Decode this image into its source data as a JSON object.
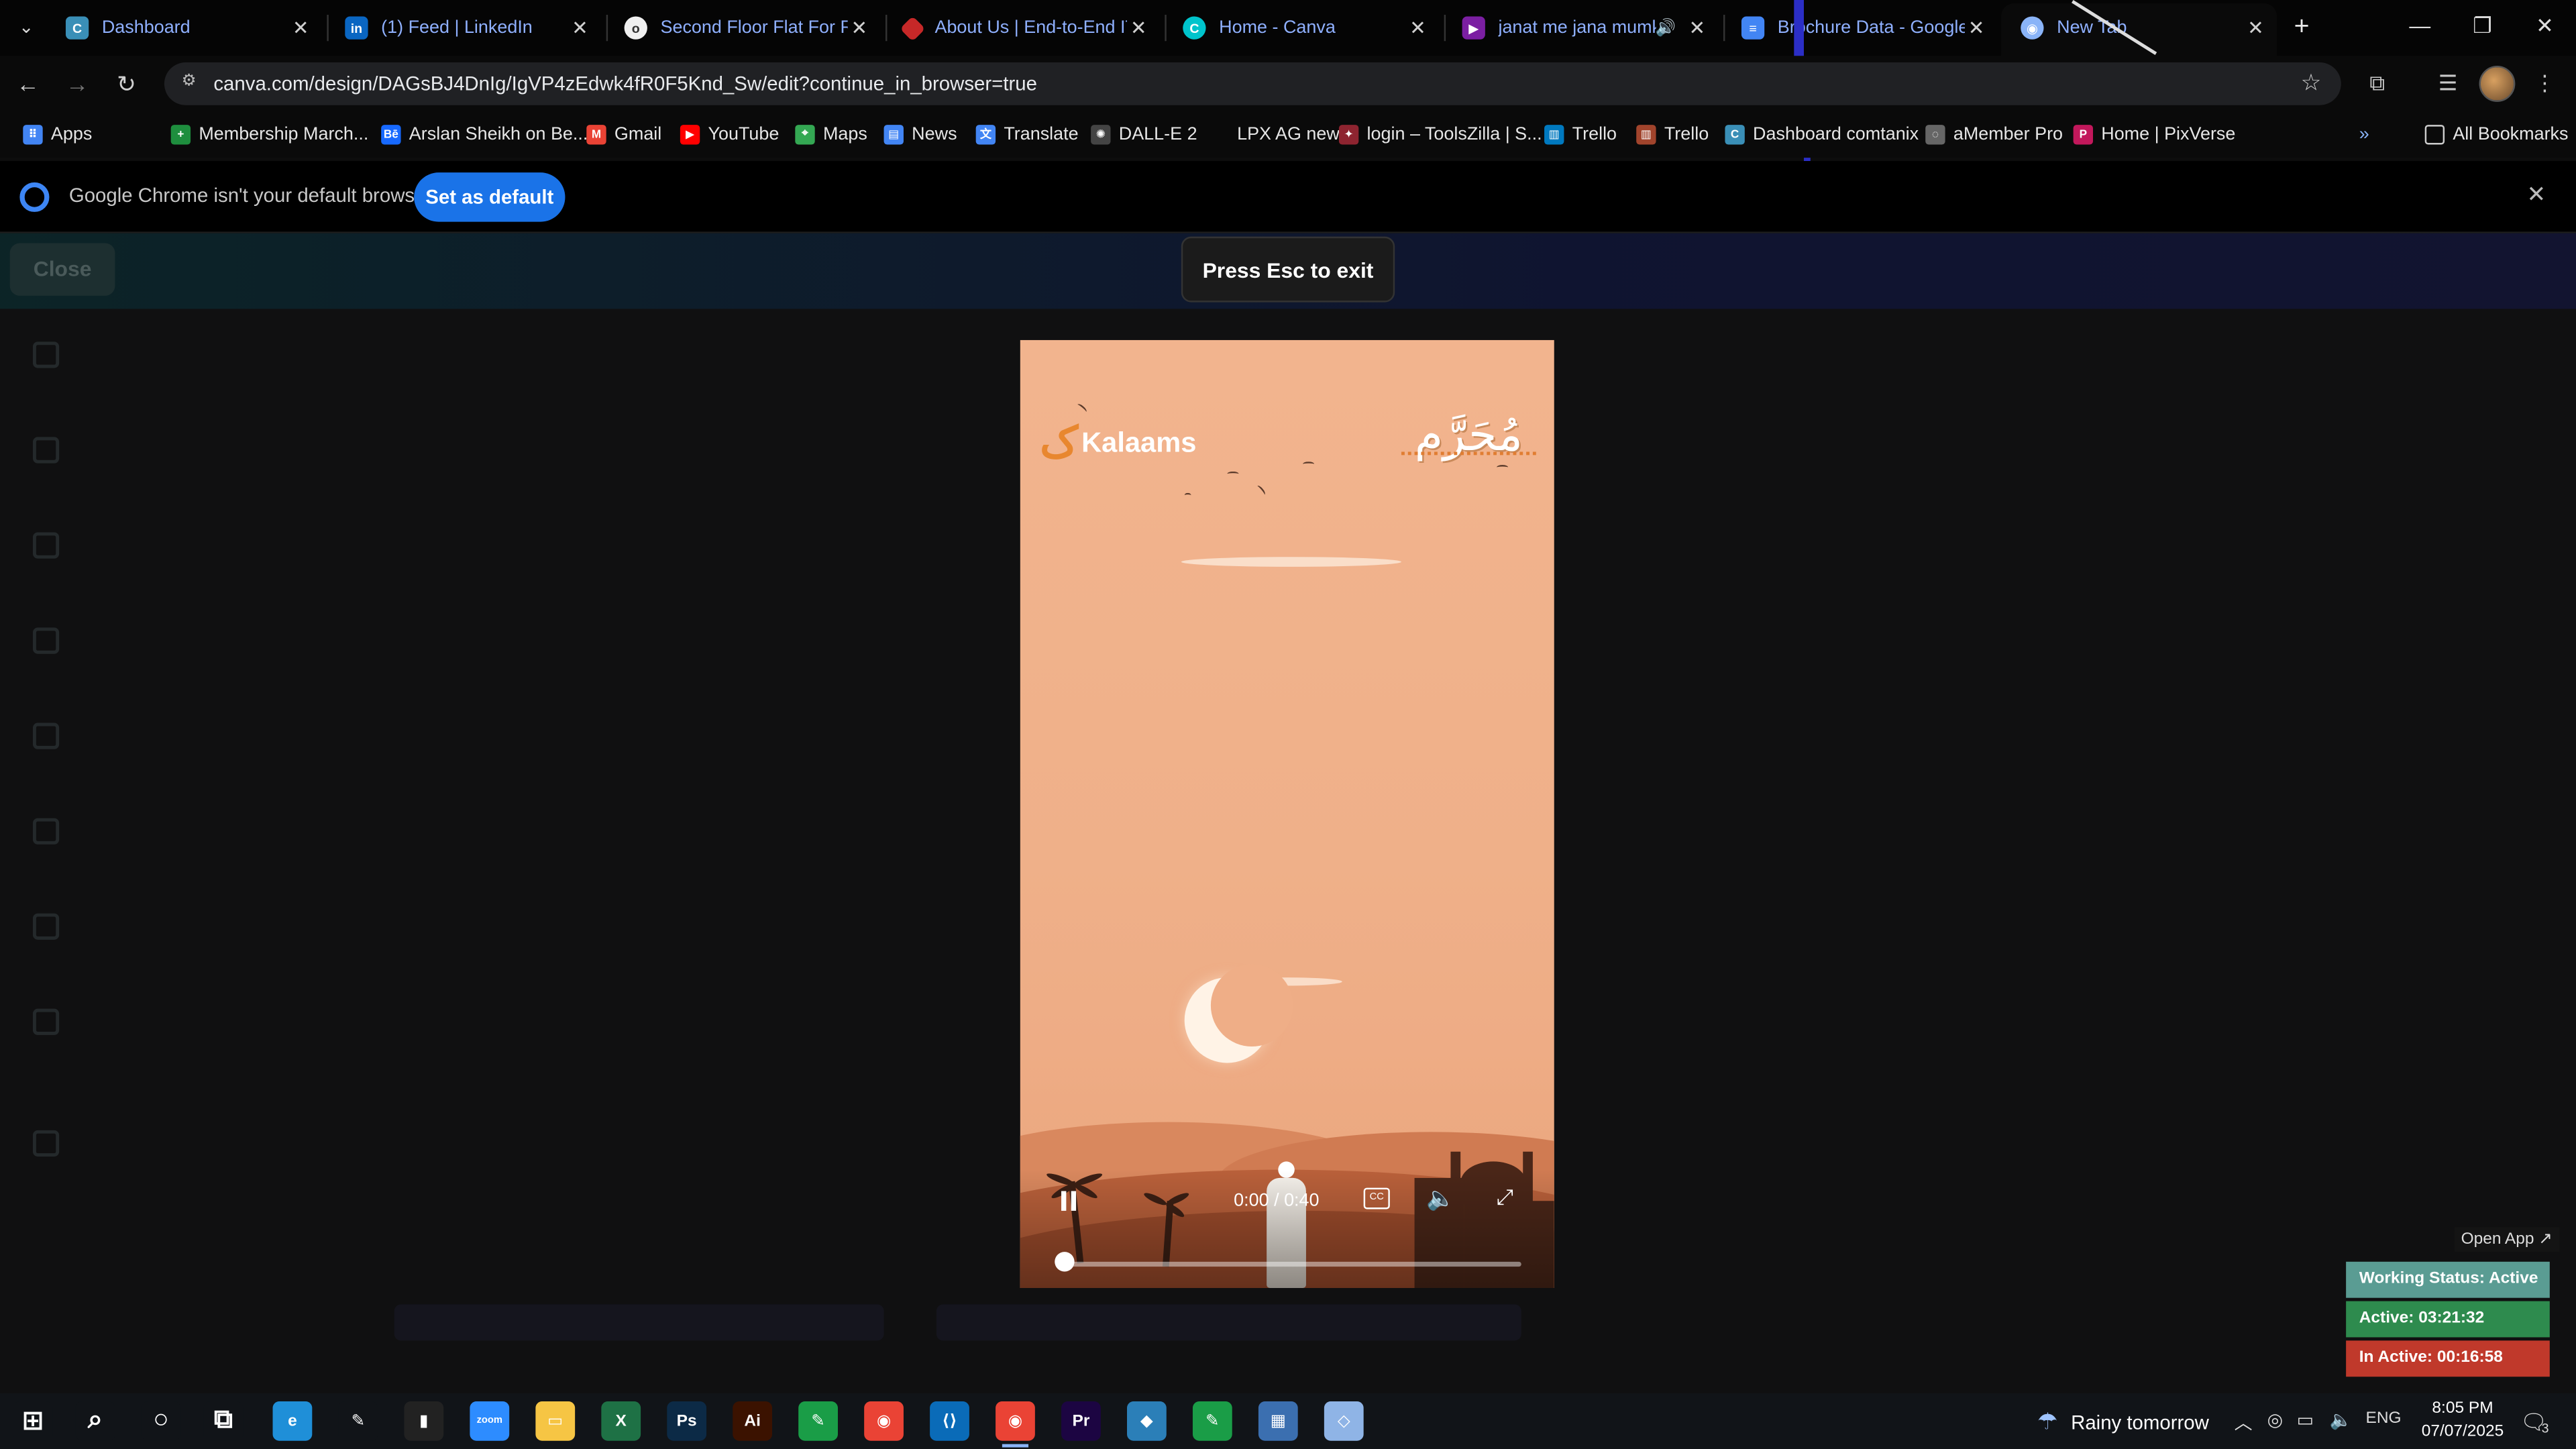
{
  "browser": {
    "tabs": [
      {
        "title": "Dashboard",
        "favicon": "canva-icon",
        "color": "#3a8fb7"
      },
      {
        "title": "(1) Feed | LinkedIn",
        "favicon": "linkedin-icon",
        "color": "#0a66c2"
      },
      {
        "title": "Second Floor Flat For Ren",
        "favicon": "olx-icon",
        "color": "#5c6bc0"
      },
      {
        "title": "About Us | End-to-End IT",
        "favicon": "site-icon",
        "color": "#c62828"
      },
      {
        "title": "Home - Canva",
        "favicon": "canva-icon",
        "color": "#00c4cc"
      },
      {
        "title": "janat me jana mumki",
        "favicon": "media-icon",
        "color": "#7b1fa2"
      },
      {
        "title": "Brochure Data - Google D",
        "favicon": "docs-icon",
        "color": "#4285f4"
      },
      {
        "title": "New Tab",
        "favicon": "chrome-icon",
        "color": "#8ab4f8"
      }
    ],
    "url": "canva.com/design/DAGsBJ4DnIg/IgVP4zEdwk4fR0F5Knd_Sw/edit?continue_in_browser=true",
    "bookmarks": [
      {
        "label": "Apps",
        "icon": "apps-grid-icon",
        "color": "#4285f4"
      },
      {
        "label": "Membership March...",
        "icon": "bookmark-green-icon",
        "color": "#1e8e3e"
      },
      {
        "label": "Arslan Sheikh on Be...",
        "icon": "behance-icon",
        "color": "#1769ff"
      },
      {
        "label": "Gmail",
        "icon": "gmail-icon",
        "color": "#ea4335"
      },
      {
        "label": "YouTube",
        "icon": "youtube-icon",
        "color": "#ff0000"
      },
      {
        "label": "Maps",
        "icon": "maps-icon",
        "color": "#34a853"
      },
      {
        "label": "News",
        "icon": "news-icon",
        "color": "#4285f4"
      },
      {
        "label": "Translate",
        "icon": "translate-icon",
        "color": "#4285f4"
      },
      {
        "label": "DALL-E 2",
        "icon": "openai-icon",
        "color": "#444444"
      },
      {
        "label": "LPX AG new",
        "icon": "blank-icon",
        "color": "#0a0a0a"
      },
      {
        "label": "login – ToolsZilla | S...",
        "icon": "toolszilla-icon",
        "color": "#8e2430"
      },
      {
        "label": "Trello",
        "icon": "trello-icon",
        "color": "#0079bf"
      },
      {
        "label": "Trello",
        "icon": "trello-icon",
        "color": "#a1442c"
      },
      {
        "label": "Dashboard comtanix",
        "icon": "canva-icon",
        "color": "#3a8fb7"
      },
      {
        "label": "aMember Pro",
        "icon": "amember-icon",
        "color": "#666666"
      },
      {
        "label": "Home | PixVerse",
        "icon": "pixverse-icon",
        "color": "#c2185b"
      }
    ],
    "all_bookmarks": "All Bookmarks",
    "more_bookmarks": "»"
  },
  "infobar": {
    "message": "Google Chrome isn't your default browser",
    "button": "Set as default"
  },
  "canva": {
    "close_label": "Close",
    "esc_toast": "Press Esc to exit",
    "open_app": "Open App ↗"
  },
  "video": {
    "brand": "Kalaams",
    "calligraphy": "مُحَرَّم",
    "time": "0:00 / 0:40",
    "progress": 0.0
  },
  "status": {
    "working": "Working Status: Active",
    "active": "Active: 03:21:32",
    "inactive": "In Active: 00:16:58"
  },
  "taskbar": {
    "weather": "Rainy tomorrow",
    "lang": "ENG",
    "time": "8:05 PM",
    "date": "07/07/2025",
    "notifications": "3",
    "apps": [
      {
        "name": "windows-start",
        "color": "#111418"
      },
      {
        "name": "search",
        "color": "#111418"
      },
      {
        "name": "cortana",
        "color": "#111418"
      },
      {
        "name": "task-view",
        "color": "#111418"
      },
      {
        "name": "edge",
        "color": "#1f8fd8"
      },
      {
        "name": "pen-tool",
        "color": "#111418"
      },
      {
        "name": "terminal",
        "color": "#222222"
      },
      {
        "name": "zoom",
        "color": "#2d8cff"
      },
      {
        "name": "file-explorer",
        "color": "#f6c544"
      },
      {
        "name": "excel",
        "color": "#1e7145"
      },
      {
        "name": "photoshop",
        "color": "#0c2a46"
      },
      {
        "name": "illustrator",
        "color": "#3b1200"
      },
      {
        "name": "pen-green",
        "color": "#1a9d47"
      },
      {
        "name": "chrome",
        "color": "#ea4335"
      },
      {
        "name": "vscode",
        "color": "#0a6bb8"
      },
      {
        "name": "chrome-active",
        "color": "#ea4335"
      },
      {
        "name": "premiere",
        "color": "#1c0542"
      },
      {
        "name": "app-blue",
        "color": "#2b7fb8"
      },
      {
        "name": "pen-green-2",
        "color": "#1a9d47"
      },
      {
        "name": "calculator",
        "color": "#3b6fb0"
      },
      {
        "name": "app-light",
        "color": "#8fb4e6"
      }
    ]
  }
}
